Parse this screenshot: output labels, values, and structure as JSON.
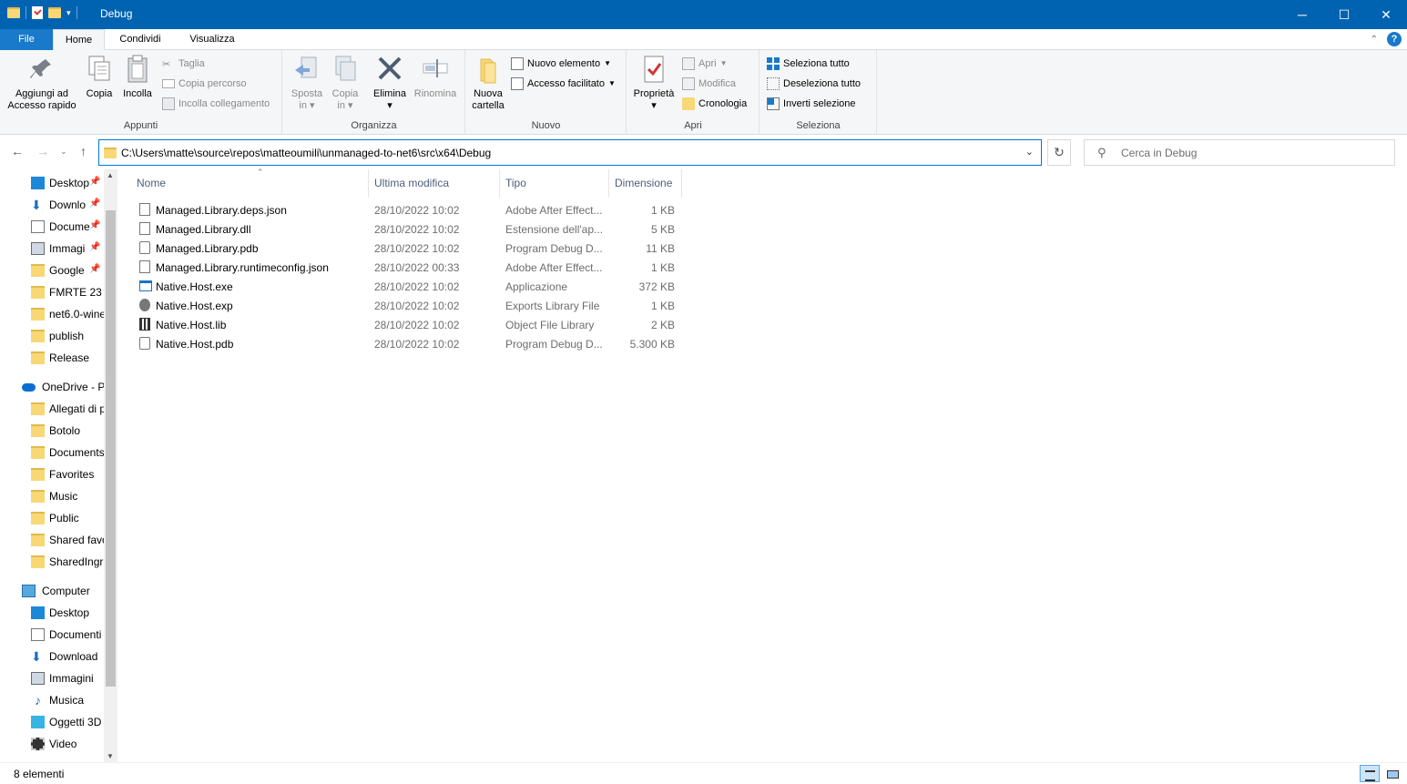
{
  "window": {
    "title": "Debug",
    "controls": {
      "minimize": "─",
      "maximize": "☐",
      "close": "✕"
    }
  },
  "ribbon_tabs": [
    {
      "label": "File"
    },
    {
      "label": "Home"
    },
    {
      "label": "Condividi"
    },
    {
      "label": "Visualizza"
    }
  ],
  "ribbon": {
    "appunti": {
      "label": "Appunti",
      "pin_label_1": "Aggiungi ad",
      "pin_label_2": "Accesso rapido",
      "copy": "Copia",
      "paste": "Incolla",
      "cut": "Taglia",
      "copy_path": "Copia percorso",
      "paste_shortcut": "Incolla collegamento"
    },
    "organizza": {
      "label": "Organizza",
      "move_1": "Sposta",
      "move_2": "in",
      "copyto_1": "Copia",
      "copyto_2": "in",
      "delete": "Elimina",
      "rename": "Rinomina"
    },
    "nuovo": {
      "label": "Nuovo",
      "new_folder_1": "Nuova",
      "new_folder_2": "cartella",
      "new_item": "Nuovo elemento",
      "easy_access": "Accesso facilitato"
    },
    "apri": {
      "label": "Apri",
      "properties": "Proprietà",
      "open": "Apri",
      "edit": "Modifica",
      "history": "Cronologia"
    },
    "seleziona": {
      "label": "Seleziona",
      "select_all": "Seleziona tutto",
      "deselect_all": "Deseleziona tutto",
      "invert": "Inverti selezione"
    }
  },
  "address": {
    "path": "C:\\Users\\matte\\source\\repos\\matteoumili\\unmanaged-to-net6\\src\\x64\\Debug",
    "search_placeholder": "Cerca in Debug"
  },
  "nav_pane": {
    "quick_access": [
      {
        "label": "Desktop",
        "icon": "desktop-icon",
        "pinned": true
      },
      {
        "label": "Downlo",
        "icon": "download-icon",
        "pinned": true
      },
      {
        "label": "Docume",
        "icon": "document-icon",
        "pinned": true
      },
      {
        "label": "Immagi",
        "icon": "pictures-icon",
        "pinned": true
      },
      {
        "label": "Google",
        "icon": "folder-icon",
        "pinned": true
      },
      {
        "label": "FMRTE 23",
        "icon": "folder-icon",
        "pinned": false
      },
      {
        "label": "net6.0-wine",
        "icon": "folder-icon",
        "pinned": false
      },
      {
        "label": "publish",
        "icon": "folder-icon",
        "pinned": false
      },
      {
        "label": "Release",
        "icon": "folder-icon",
        "pinned": false
      }
    ],
    "onedrive": {
      "label": "OneDrive - P",
      "icon": "onedrive-icon"
    },
    "onedrive_items": [
      {
        "label": "Allegati di p",
        "icon": "folder-icon"
      },
      {
        "label": "Botolo",
        "icon": "folder-icon"
      },
      {
        "label": "Documents",
        "icon": "folder-icon"
      },
      {
        "label": "Favorites",
        "icon": "folder-icon"
      },
      {
        "label": "Music",
        "icon": "folder-icon"
      },
      {
        "label": "Public",
        "icon": "folder-icon"
      },
      {
        "label": "Shared favo",
        "icon": "folder-icon"
      },
      {
        "label": "SharedIngr",
        "icon": "folder-icon"
      }
    ],
    "computer": {
      "label": "Computer",
      "icon": "computer-icon"
    },
    "computer_items": [
      {
        "label": "Desktop",
        "icon": "desktop-icon"
      },
      {
        "label": "Documenti",
        "icon": "document-icon"
      },
      {
        "label": "Download",
        "icon": "download-icon"
      },
      {
        "label": "Immagini",
        "icon": "pictures-icon"
      },
      {
        "label": "Musica",
        "icon": "music-icon"
      },
      {
        "label": "Oggetti 3D",
        "icon": "3d-objects-icon"
      },
      {
        "label": "Video",
        "icon": "video-icon"
      }
    ]
  },
  "columns": {
    "name": "Nome",
    "modified": "Ultima modifica",
    "type": "Tipo",
    "size": "Dimensione"
  },
  "files": [
    {
      "name": "Managed.Library.deps.json",
      "modified": "28/10/2022 10:02",
      "type": "Adobe After Effect...",
      "size": "1 KB",
      "icon": "json-file-icon"
    },
    {
      "name": "Managed.Library.dll",
      "modified": "28/10/2022 10:02",
      "type": "Estensione dell'ap...",
      "size": "5 KB",
      "icon": "dll-file-icon"
    },
    {
      "name": "Managed.Library.pdb",
      "modified": "28/10/2022 10:02",
      "type": "Program Debug D...",
      "size": "11 KB",
      "icon": "pdb-file-icon"
    },
    {
      "name": "Managed.Library.runtimeconfig.json",
      "modified": "28/10/2022 00:33",
      "type": "Adobe After Effect...",
      "size": "1 KB",
      "icon": "json-file-icon"
    },
    {
      "name": "Native.Host.exe",
      "modified": "28/10/2022 10:02",
      "type": "Applicazione",
      "size": "372 KB",
      "icon": "exe-file-icon"
    },
    {
      "name": "Native.Host.exp",
      "modified": "28/10/2022 10:02",
      "type": "Exports Library File",
      "size": "1 KB",
      "icon": "exp-file-icon"
    },
    {
      "name": "Native.Host.lib",
      "modified": "28/10/2022 10:02",
      "type": "Object File Library",
      "size": "2 KB",
      "icon": "lib-file-icon"
    },
    {
      "name": "Native.Host.pdb",
      "modified": "28/10/2022 10:02",
      "type": "Program Debug D...",
      "size": "5.300 KB",
      "icon": "pdb-file-icon"
    }
  ],
  "status": {
    "count": "8 elementi"
  }
}
